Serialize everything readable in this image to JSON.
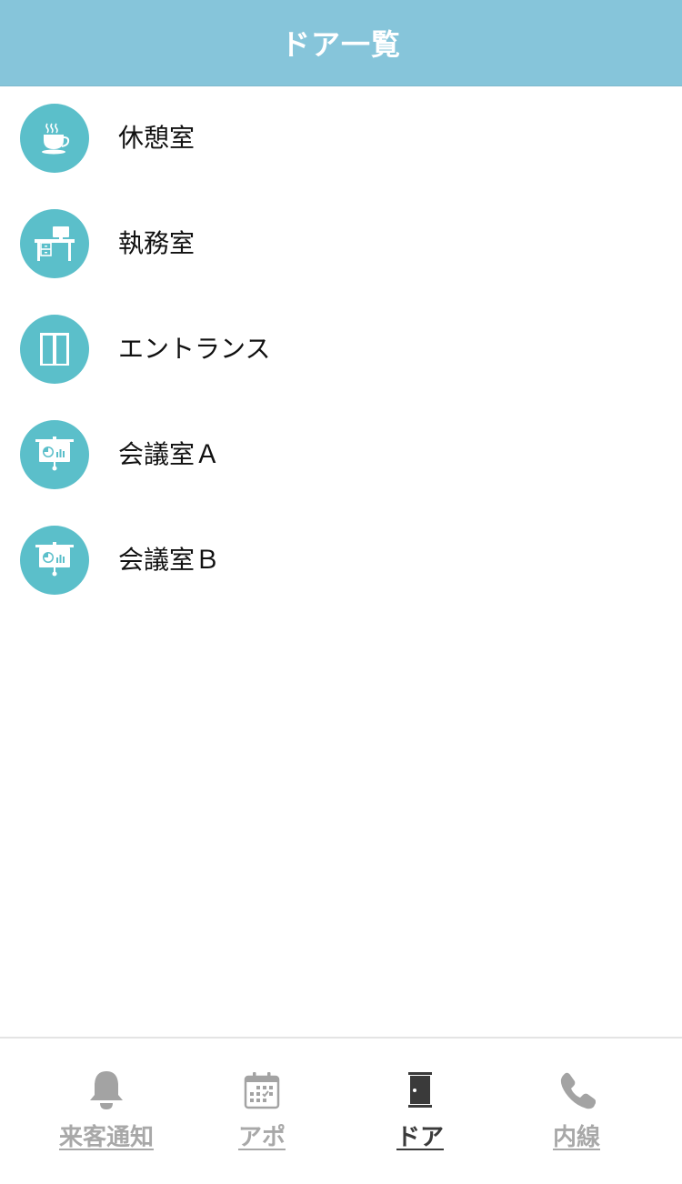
{
  "header": {
    "title": "ドア一覧"
  },
  "doors": [
    {
      "label": "休憩室",
      "icon": "coffee-cup-icon"
    },
    {
      "label": "執務室",
      "icon": "office-desk-icon"
    },
    {
      "label": "エントランス",
      "icon": "entrance-door-icon"
    },
    {
      "label": "会議室Ａ",
      "icon": "presentation-board-icon"
    },
    {
      "label": "会議室Ｂ",
      "icon": "presentation-board-icon"
    }
  ],
  "tabs": [
    {
      "label": "来客通知",
      "icon": "bell-icon",
      "active": false
    },
    {
      "label": "アポ",
      "icon": "calendar-icon",
      "active": false
    },
    {
      "label": "ドア",
      "icon": "door-icon",
      "active": true
    },
    {
      "label": "内線",
      "icon": "phone-icon",
      "active": false
    }
  ],
  "colors": {
    "header_bg": "#86c5da",
    "icon_circle": "#5bbfca",
    "tab_inactive": "#a8a8a8",
    "tab_active": "#3a3a3a"
  }
}
